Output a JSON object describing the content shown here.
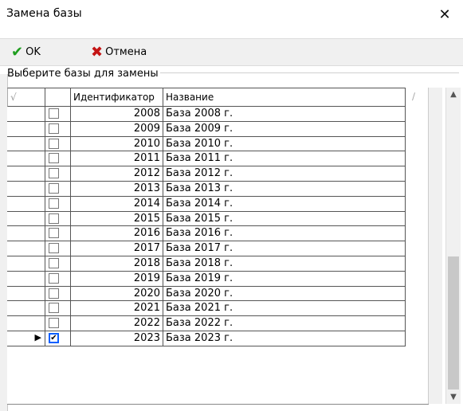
{
  "window": {
    "title": "Замена базы",
    "close_glyph": "✕"
  },
  "toolbar": {
    "ok_label": "OK",
    "ok_icon": "checkmark-icon",
    "cancel_label": "Отмена",
    "cancel_icon": "x-icon"
  },
  "group": {
    "legend": "Выберите базы для замены"
  },
  "grid": {
    "columns": [
      "",
      "",
      "Идентификатор",
      "Название"
    ],
    "rows": [
      {
        "checked": false,
        "id": "2008",
        "name": "База 2008 г."
      },
      {
        "checked": false,
        "id": "2009",
        "name": "База 2009 г."
      },
      {
        "checked": false,
        "id": "2010",
        "name": "База 2010 г."
      },
      {
        "checked": false,
        "id": "2011",
        "name": "База 2011 г."
      },
      {
        "checked": false,
        "id": "2012",
        "name": "База 2012 г."
      },
      {
        "checked": false,
        "id": "2013",
        "name": "База 2013 г."
      },
      {
        "checked": false,
        "id": "2014",
        "name": "База 2014 г."
      },
      {
        "checked": false,
        "id": "2015",
        "name": "База 2015 г."
      },
      {
        "checked": false,
        "id": "2016",
        "name": "База 2016 г."
      },
      {
        "checked": false,
        "id": "2017",
        "name": "База 2017 г."
      },
      {
        "checked": false,
        "id": "2018",
        "name": "База 2018 г."
      },
      {
        "checked": false,
        "id": "2019",
        "name": "База 2019 г."
      },
      {
        "checked": false,
        "id": "2020",
        "name": "База 2020 г."
      },
      {
        "checked": false,
        "id": "2021",
        "name": "База 2021 г."
      },
      {
        "checked": false,
        "id": "2022",
        "name": "База 2022 г."
      },
      {
        "checked": true,
        "id": "2023",
        "name": "База 2023 г.",
        "current": true
      }
    ]
  },
  "colors": {
    "ok": "#1f9e1f",
    "cancel": "#c41414",
    "checkbox_focus": "#0b5fff"
  }
}
